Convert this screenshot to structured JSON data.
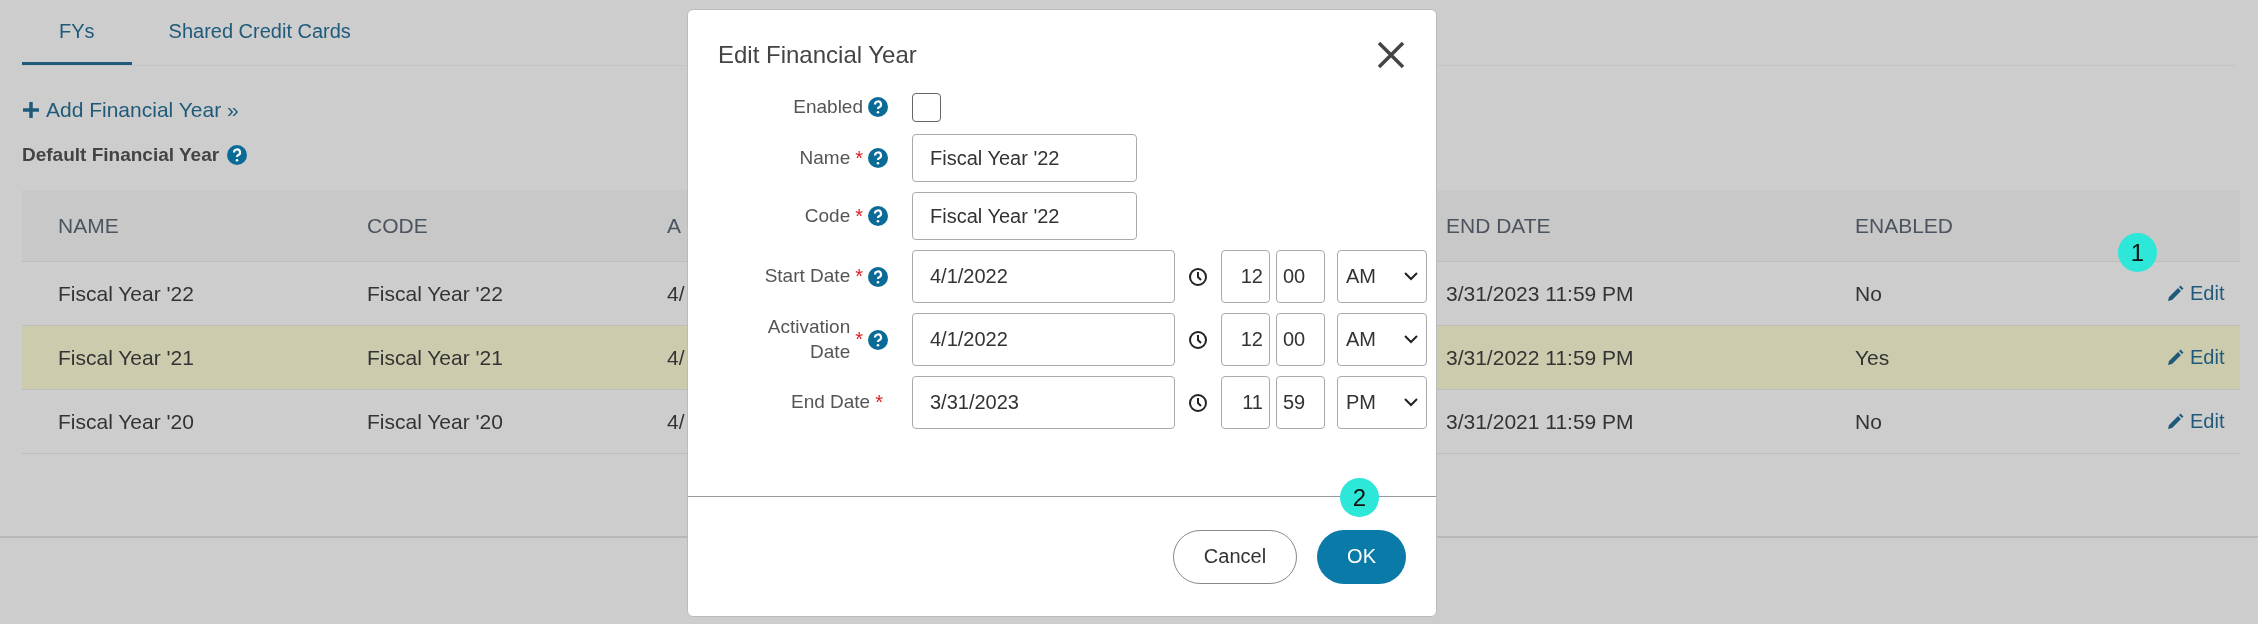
{
  "tabs": [
    {
      "label": "FYs",
      "selected": true
    },
    {
      "label": "Shared Credit Cards",
      "selected": false
    }
  ],
  "add_link": {
    "label": "Add Financial Year »"
  },
  "section_title": "Default Financial Year",
  "table": {
    "columns": [
      "NAME",
      "CODE",
      "A",
      "END DATE",
      "ENABLED"
    ],
    "rows": [
      {
        "cells": [
          "Fiscal Year '22",
          "Fiscal Year '22",
          "4/",
          "3/31/2023 11:59 PM",
          "No"
        ],
        "action": "Edit",
        "selected": false,
        "badge": "1"
      },
      {
        "cells": [
          "Fiscal Year '21",
          "Fiscal Year '21",
          "4/",
          "3/31/2022 11:59 PM",
          "Yes"
        ],
        "action": "Edit",
        "selected": true
      },
      {
        "cells": [
          "Fiscal Year '20",
          "Fiscal Year '20",
          "4/",
          "3/31/2021 11:59 PM",
          "No"
        ],
        "action": "Edit",
        "selected": false
      }
    ]
  },
  "dialog": {
    "title": "Edit Financial Year",
    "fields": [
      {
        "kind": "checkbox",
        "label": "Enabled",
        "help": true,
        "checked": false
      },
      {
        "kind": "text",
        "label": "Name",
        "required_mark": "*",
        "help": true,
        "value": "Fiscal Year '22"
      },
      {
        "kind": "text",
        "label": "Code",
        "required_mark": "*",
        "help": true,
        "value": "Fiscal Year '22"
      },
      {
        "kind": "datetime",
        "label": "Start Date",
        "required_mark": "*",
        "help": true,
        "value": "4/1/2022",
        "hour": "12",
        "minute": "00",
        "ampm": "AM"
      },
      {
        "kind": "datetime",
        "label": "Activation Date",
        "required_mark": "*",
        "help": true,
        "value": "4/1/2022",
        "hour": "12",
        "minute": "00",
        "ampm": "AM"
      },
      {
        "kind": "datetime",
        "label": "End Date",
        "required_mark": "*",
        "help": false,
        "value": "3/31/2023",
        "hour": "11",
        "minute": "59",
        "ampm": "PM"
      }
    ],
    "badge": "2",
    "buttons": [
      {
        "label": "Cancel",
        "kind": "secondary"
      },
      {
        "label": "OK",
        "kind": "primary"
      }
    ]
  }
}
